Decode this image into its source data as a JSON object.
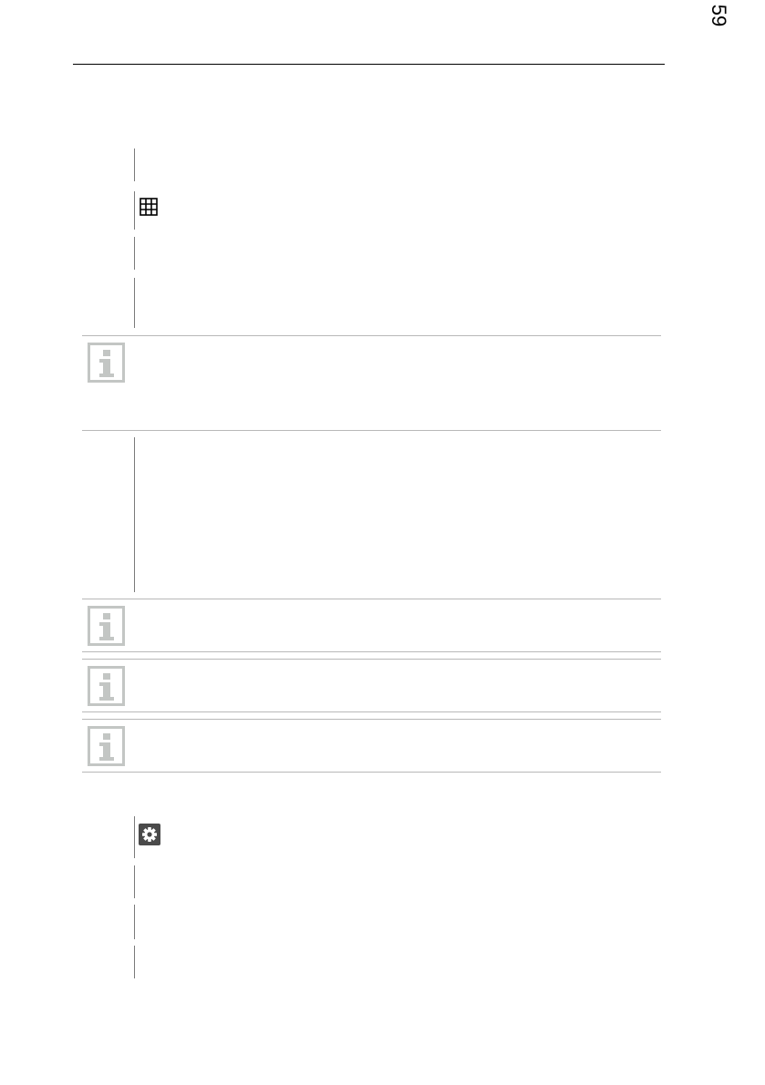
{
  "header": {
    "page_number": "59"
  },
  "icons": {
    "table_view": "table-grid-icon",
    "settings": "gear-icon",
    "note": "info-icon"
  },
  "colors": {
    "rule": "#b8b8b8",
    "step_bar": "#7a7a7a",
    "info_icon": "#c3c6c4"
  }
}
